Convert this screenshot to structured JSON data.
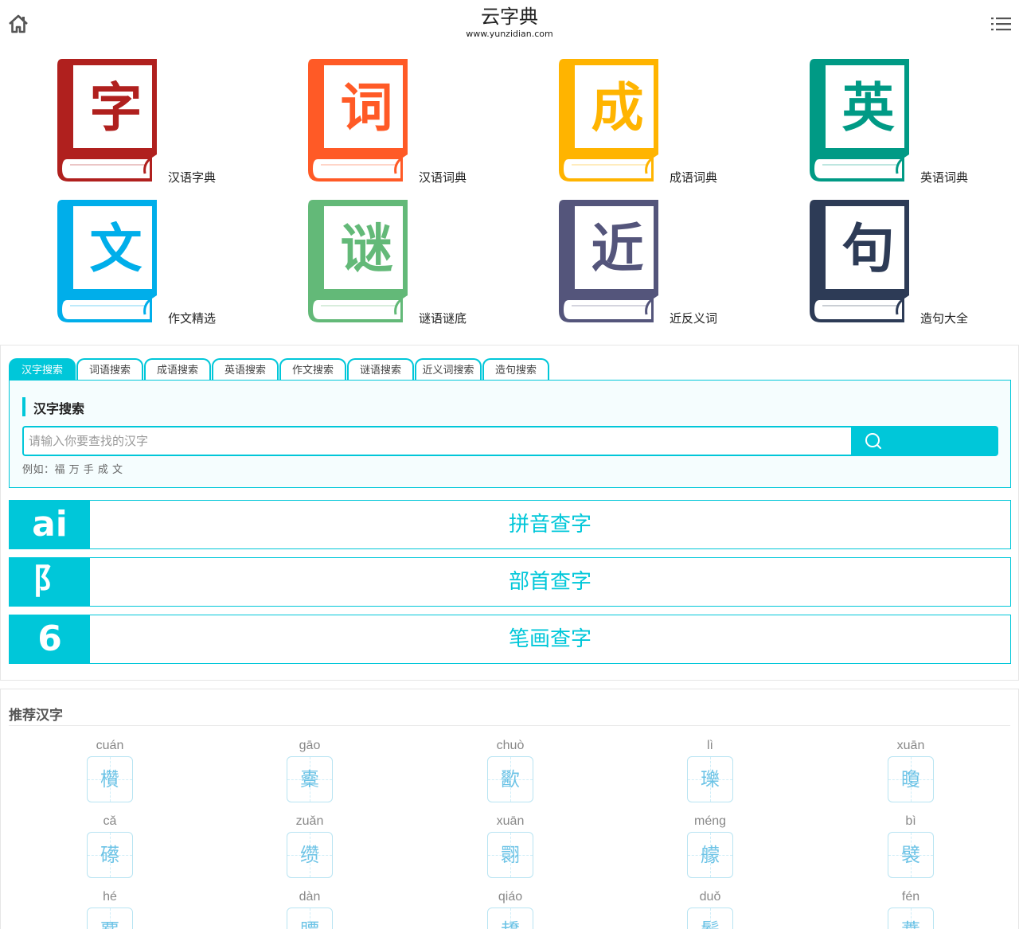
{
  "header": {
    "title": "云字典",
    "url": "www.yunzidian.com",
    "home_icon": "home-icon",
    "menu_icon": "list-menu-icon"
  },
  "dictionaries": [
    {
      "char": "字",
      "label": "汉语字典",
      "color": "#b0201e"
    },
    {
      "char": "词",
      "label": "汉语词典",
      "color": "#ff5a26"
    },
    {
      "char": "成",
      "label": "成语词典",
      "color": "#ffb400"
    },
    {
      "char": "英",
      "label": "英语词典",
      "color": "#009a85"
    },
    {
      "char": "文",
      "label": "作文精选",
      "color": "#00aeea"
    },
    {
      "char": "谜",
      "label": "谜语谜底",
      "color": "#63b978"
    },
    {
      "char": "近",
      "label": "近反义词",
      "color": "#54557b"
    },
    {
      "char": "句",
      "label": "造句大全",
      "color": "#2d3b56"
    }
  ],
  "search": {
    "tabs": [
      "汉字搜索",
      "词语搜索",
      "成语搜索",
      "英语搜索",
      "作文搜索",
      "谜语搜索",
      "近义词搜索",
      "造句搜索"
    ],
    "active_tab": 0,
    "heading": "汉字搜索",
    "placeholder": "请输入你要查找的汉字",
    "value": "",
    "examples": "例如：福 万 手 成 文",
    "button_icon": "search-icon",
    "accent": "#00c7d9"
  },
  "lookups": [
    {
      "badge": "ai",
      "label": "拼音查字"
    },
    {
      "badge": "阝",
      "label": "部首查字"
    },
    {
      "badge": "6",
      "label": "笔画查字"
    }
  ],
  "recommended": {
    "title": "推荐汉字",
    "items": [
      {
        "pinyin": "cuán",
        "char": "欑"
      },
      {
        "pinyin": "gāo",
        "char": "櫜"
      },
      {
        "pinyin": "chuò",
        "char": "歠"
      },
      {
        "pinyin": "lì",
        "char": "瓅"
      },
      {
        "pinyin": "xuān",
        "char": "矎"
      },
      {
        "pinyin": "cǎ",
        "char": "礤"
      },
      {
        "pinyin": "zuǎn",
        "char": "缵"
      },
      {
        "pinyin": "xuān",
        "char": "翾"
      },
      {
        "pinyin": "méng",
        "char": "艨"
      },
      {
        "pinyin": "bì",
        "char": "襞"
      },
      {
        "pinyin": "hé",
        "char": "覈"
      },
      {
        "pinyin": "dàn",
        "char": "贉"
      },
      {
        "pinyin": "qiáo",
        "char": "趫"
      },
      {
        "pinyin": "duǒ",
        "char": "鬌"
      },
      {
        "pinyin": "fén",
        "char": "蕡"
      }
    ]
  }
}
